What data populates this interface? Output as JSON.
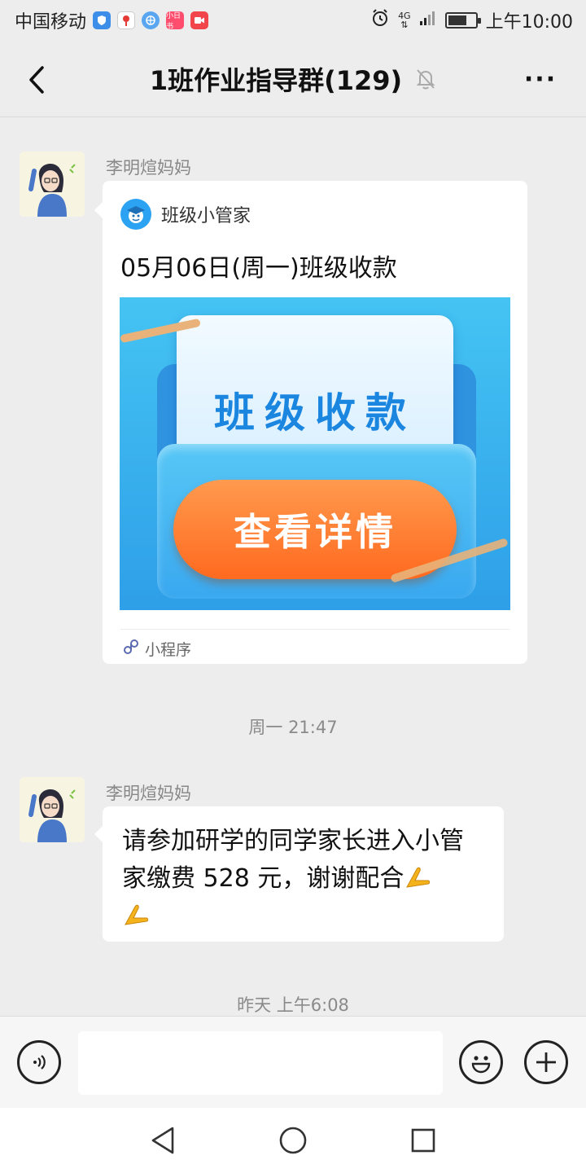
{
  "status_bar": {
    "carrier": "中国移动",
    "app_icon_label": "小日书",
    "network": "4G",
    "time": "上午10:00",
    "battery_level": 0.7
  },
  "header": {
    "title": "1班作业指导群(129)",
    "back_icon": "chevron-left-icon",
    "mute_icon": "bell-off-icon",
    "more_label": "···"
  },
  "messages": {
    "msg1": {
      "sender": "李明煊妈妈",
      "card": {
        "app_name": "班级小管家",
        "title": "05月06日(周一)班级收款",
        "banner_heading": "班级收款",
        "banner_button": "查看详情",
        "footer_label": "小程序"
      }
    },
    "time1": "周一 21:47",
    "msg2": {
      "sender": "李明煊妈妈",
      "text": "请参加研学的同学家长进入小管家缴费 528 元，谢谢配合"
    },
    "time2": "昨天 上午6:08"
  },
  "input_bar": {
    "voice_icon": "voice-icon",
    "placeholder": "",
    "emoji_icon": "emoji-icon",
    "plus_icon": "plus-icon"
  },
  "system_nav": {
    "back_icon": "triangle-back-icon",
    "home_icon": "circle-home-icon",
    "recents_icon": "square-recents-icon"
  },
  "colors": {
    "background": "#ededed",
    "accent_blue": "#2ba3f2",
    "button_orange": "#ff7a2e"
  }
}
